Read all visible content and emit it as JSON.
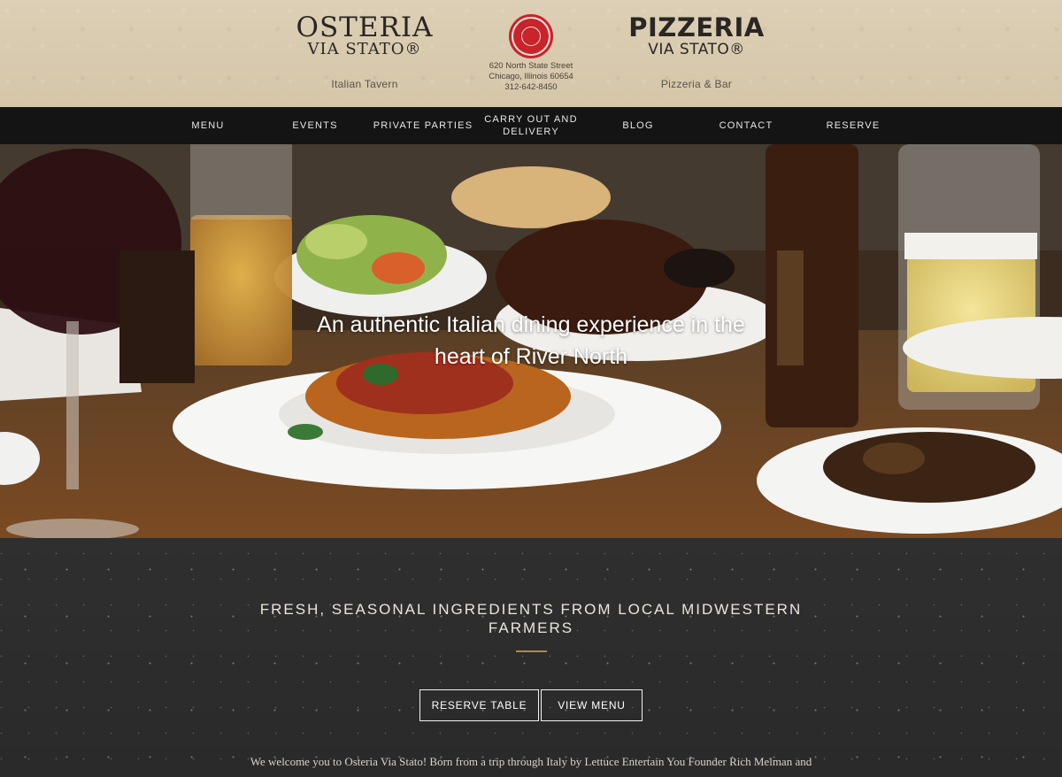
{
  "header": {
    "osteria": {
      "line1": "OSTERIA",
      "line2": "VIA STATO®",
      "subtitle": "Italian Tavern"
    },
    "pizzeria": {
      "line1": "PIZZERIA",
      "line2": "VIA STATO®",
      "subtitle": "Pizzeria & Bar"
    },
    "address": {
      "street": "620 North State Street",
      "city": "Chicago, Illinois 60654",
      "phone": "312-642-8450"
    }
  },
  "nav": {
    "items": [
      {
        "label": "MENU"
      },
      {
        "label": "EVENTS"
      },
      {
        "label": "PRIVATE PARTIES"
      },
      {
        "label": "CARRY OUT AND DELIVERY"
      },
      {
        "label": "BLOG"
      },
      {
        "label": "CONTACT"
      },
      {
        "label": "RESERVE"
      }
    ]
  },
  "hero": {
    "tagline": "An authentic Italian dining experience in the heart of River North"
  },
  "section": {
    "heading": "FRESH, SEASONAL INGREDIENTS FROM LOCAL MIDWESTERN FARMERS",
    "reserve_label": "RESERVE TABLE",
    "menu_label": "VIEW MENU",
    "intro": "We welcome you to Osteria Via Stato! Born from a trip through Italy by Lettuce Entertain You Founder Rich Melman and"
  },
  "colors": {
    "header_bg": "#d9cbb0",
    "nav_bg": "#141414",
    "seal_red": "#c9242b",
    "accent_gold": "#b08a43",
    "board_bg": "#2d2d2d"
  }
}
